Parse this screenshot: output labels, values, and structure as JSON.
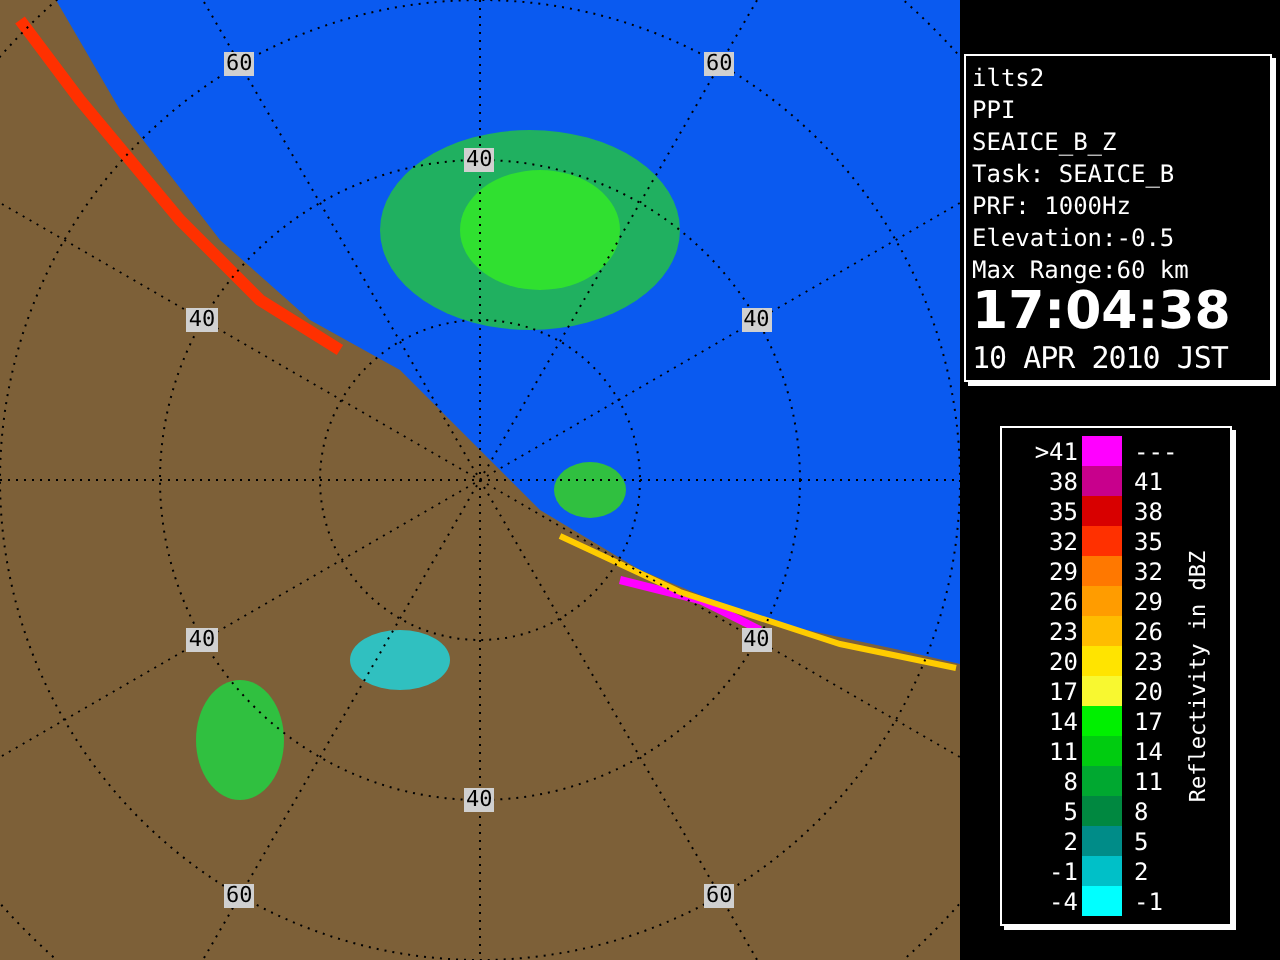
{
  "radar_map": {
    "range_labels": [
      "60",
      "60",
      "40",
      "40",
      "40",
      "40",
      "40",
      "40",
      "60",
      "60"
    ]
  },
  "info": {
    "lines": [
      "ilts2",
      "PPI",
      "SEAICE_B_Z",
      "Task: SEAICE_B",
      "PRF: 1000Hz",
      "Elevation:-0.5",
      "Max Range:60 km"
    ],
    "time": "17:04:38",
    "date": "10 APR 2010 JST"
  },
  "legend": {
    "title": "Reflectivity in dBZ",
    "rows": [
      {
        "low": ">41",
        "high": "---",
        "color": "#ff00ff"
      },
      {
        "low": "38",
        "high": "41",
        "color": "#c8008c"
      },
      {
        "low": "35",
        "high": "38",
        "color": "#d80000"
      },
      {
        "low": "32",
        "high": "35",
        "color": "#ff3000"
      },
      {
        "low": "29",
        "high": "32",
        "color": "#ff7800"
      },
      {
        "low": "26",
        "high": "29",
        "color": "#ff9c00"
      },
      {
        "low": "23",
        "high": "26",
        "color": "#ffbc00"
      },
      {
        "low": "20",
        "high": "23",
        "color": "#ffe400"
      },
      {
        "low": "17",
        "high": "20",
        "color": "#f8f830"
      },
      {
        "low": "14",
        "high": "17",
        "color": "#00f000"
      },
      {
        "low": "11",
        "high": "14",
        "color": "#00cc10"
      },
      {
        "low": "8",
        "high": "11",
        "color": "#00a830"
      },
      {
        "low": "5",
        "high": "8",
        "color": "#008840"
      },
      {
        "low": "2",
        "high": "5",
        "color": "#008c88"
      },
      {
        "low": "-1",
        "high": "2",
        "color": "#00c0c8"
      },
      {
        "low": "-4",
        "high": "-1",
        "color": "#00ffff"
      }
    ]
  }
}
